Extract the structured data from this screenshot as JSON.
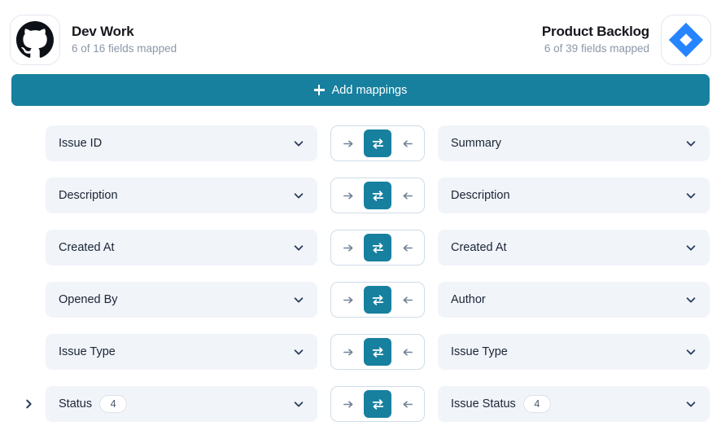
{
  "header": {
    "left": {
      "logo_icon": "github-icon",
      "title": "Dev Work",
      "subtitle": "6 of 16 fields mapped"
    },
    "right": {
      "logo_icon": "jira-icon",
      "title": "Product Backlog",
      "subtitle": "6 of 39 fields mapped"
    }
  },
  "toolbar": {
    "add_mappings_label": "Add mappings",
    "add_icon": "plus-icon"
  },
  "colors": {
    "accent": "#17809f",
    "field_bg": "#f1f4f9",
    "jira_blue": "#2684ff",
    "github_black": "#0d1117",
    "text": "#1b2536",
    "muted": "#8c97a8"
  },
  "direction_options": [
    {
      "value": "right",
      "icon": "arrow-right-icon"
    },
    {
      "value": "bidirectional",
      "icon": "sync-bidirectional-icon"
    },
    {
      "value": "left",
      "icon": "arrow-left-icon"
    }
  ],
  "mappings": [
    {
      "expandable": false,
      "left": {
        "label": "Issue ID",
        "count": null
      },
      "direction": "bidirectional",
      "right": {
        "label": "Summary",
        "count": null
      }
    },
    {
      "expandable": false,
      "left": {
        "label": "Description",
        "count": null
      },
      "direction": "bidirectional",
      "right": {
        "label": "Description",
        "count": null
      }
    },
    {
      "expandable": false,
      "left": {
        "label": "Created At",
        "count": null
      },
      "direction": "bidirectional",
      "right": {
        "label": "Created At",
        "count": null
      }
    },
    {
      "expandable": false,
      "left": {
        "label": "Opened By",
        "count": null
      },
      "direction": "bidirectional",
      "right": {
        "label": "Author",
        "count": null
      }
    },
    {
      "expandable": false,
      "left": {
        "label": "Issue Type",
        "count": null
      },
      "direction": "bidirectional",
      "right": {
        "label": "Issue Type",
        "count": null
      }
    },
    {
      "expandable": true,
      "left": {
        "label": "Status",
        "count": "4"
      },
      "direction": "bidirectional",
      "right": {
        "label": "Issue Status",
        "count": "4"
      }
    }
  ]
}
